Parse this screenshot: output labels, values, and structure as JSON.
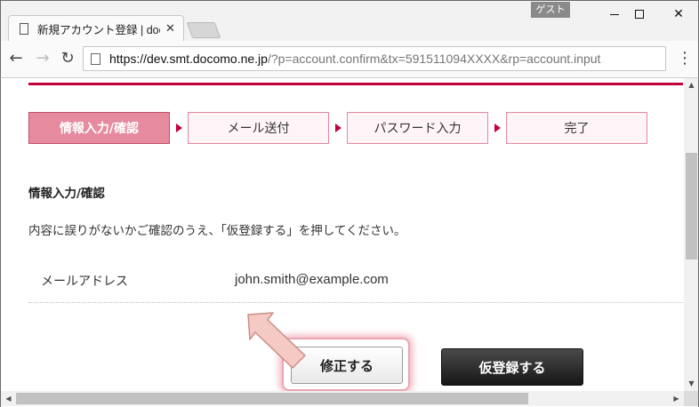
{
  "window": {
    "guest_label": "ゲスト",
    "minimize_symbol": "",
    "close_symbol": "✕"
  },
  "tab": {
    "title": "新規アカウント登録 | docomo",
    "close_symbol": "✕"
  },
  "toolbar": {
    "back_symbol": "←",
    "forward_symbol": "→",
    "reload_symbol": "↻",
    "url_host": "https://dev.smt.docomo.ne.jp",
    "url_path": "/?p=account.confirm&tx=591511094XXXX&rp=account.input",
    "menu_symbol": "⋮"
  },
  "steps": [
    {
      "label": "情報入力/確認",
      "active": true
    },
    {
      "label": "メール送付",
      "active": false
    },
    {
      "label": "パスワード入力",
      "active": false
    },
    {
      "label": "完了",
      "active": false
    }
  ],
  "section": {
    "title": "情報入力/確認",
    "instruction": "内容に誤りがないかご確認のうえ、「仮登録する」を押してください。"
  },
  "fields": [
    {
      "label": "メールアドレス",
      "value": "john.smith@example.com"
    }
  ],
  "buttons": {
    "edit": "修正する",
    "register": "仮登録する"
  },
  "scrollbar": {
    "up": "▲",
    "down": "▼",
    "left": "◀",
    "right": "▶"
  },
  "colors": {
    "accent": "#c4003a",
    "step_active": "#e68a9f",
    "step_inactive_bg": "#fff4f7",
    "highlight": "#e9a6b0"
  }
}
